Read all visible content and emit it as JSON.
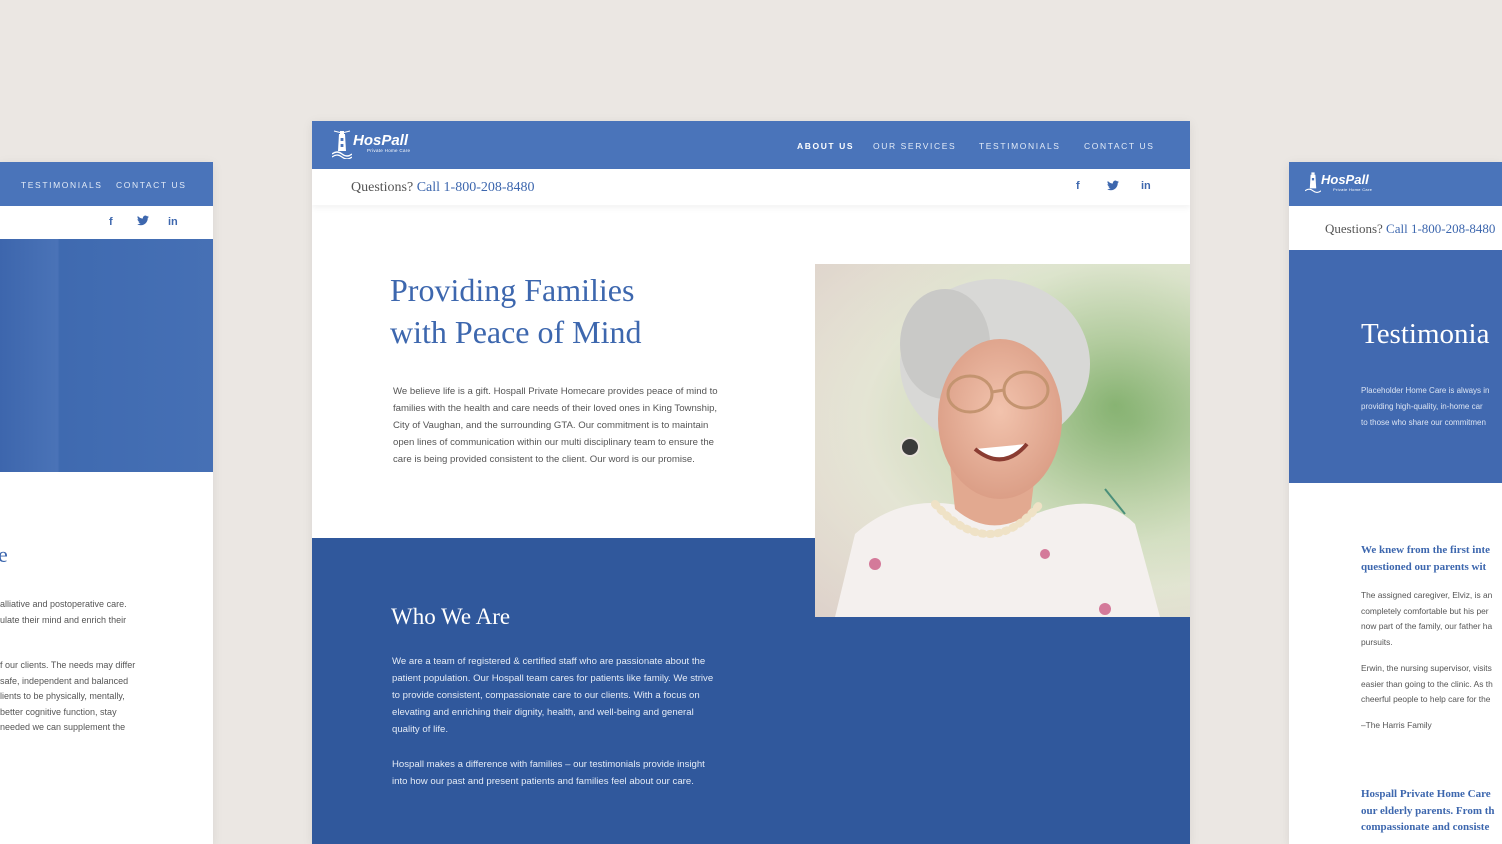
{
  "brand": {
    "name": "HosPall",
    "tagline": "Private Home Care"
  },
  "colors": {
    "primary": "#4a74ba",
    "dark": "#30589c",
    "background": "#ebe7e3"
  },
  "nav": [
    "About Us",
    "Our Services",
    "Testimonials",
    "Contact Us"
  ],
  "questions": {
    "prefix": "Questions?",
    "call": "Call 1-800-208-8480"
  },
  "social": [
    "f",
    "t",
    "in"
  ],
  "social_icons": [
    "facebook-icon",
    "twitter-icon",
    "linkedin-icon"
  ],
  "left": {
    "nav": [
      "Testimonials",
      "Contact Us"
    ],
    "heading_fragment": "e",
    "p1": [
      "alliative and postoperative care.",
      "ulate their mind and enrich their"
    ],
    "p2": [
      "f our clients. The needs may differ",
      "safe, independent and balanced",
      "lients to be physically, mentally,",
      "better cognitive function, stay",
      "needed we can supplement the"
    ]
  },
  "center": {
    "hero_title": [
      "Providing Families",
      "with Peace of Mind"
    ],
    "hero_paragraph": "We believe life is a gift. Hospall Private Homecare provides peace of mind to families with the health and care needs of their loved ones in King Township, City of Vaughan, and the surrounding GTA. Our commitment is to maintain open lines of communication within our multi disciplinary team to ensure the care is being provided consistent to the client. Our word is our promise.",
    "who_title": "Who We Are",
    "who_p1": "We are a team of registered & certified staff who are passionate about the patient population. Our Hospall team cares for patients like family. We strive to provide consistent, compassionate care to our clients. With a focus on elevating and enriching their dignity, health, and well-being and general quality of life.",
    "who_p2": "Hospall makes a difference with families – our testimonials provide insight into how our past and present patients and families feel about our care."
  },
  "right": {
    "title": "Testimonia",
    "intro": [
      "Placeholder Home Care is always in",
      "providing high-quality, in-home car",
      "to those who share our commitmen"
    ],
    "quote1_heading": [
      "We knew from the first inte",
      "questioned our parents wit"
    ],
    "quote1_p1": [
      "The assigned caregiver, Elviz, is an",
      "completely comfortable but his per",
      "now part of the family, our father ha",
      "pursuits."
    ],
    "quote1_p2": [
      "Erwin, the nursing supervisor, visits",
      "easier than going to the clinic. As th",
      "cheerful people to help care for the"
    ],
    "quote1_author": "–The Harris Family",
    "quote2_heading": [
      "Hospall Private Home Care",
      "our elderly parents. From th",
      "compassionate and consiste"
    ]
  }
}
